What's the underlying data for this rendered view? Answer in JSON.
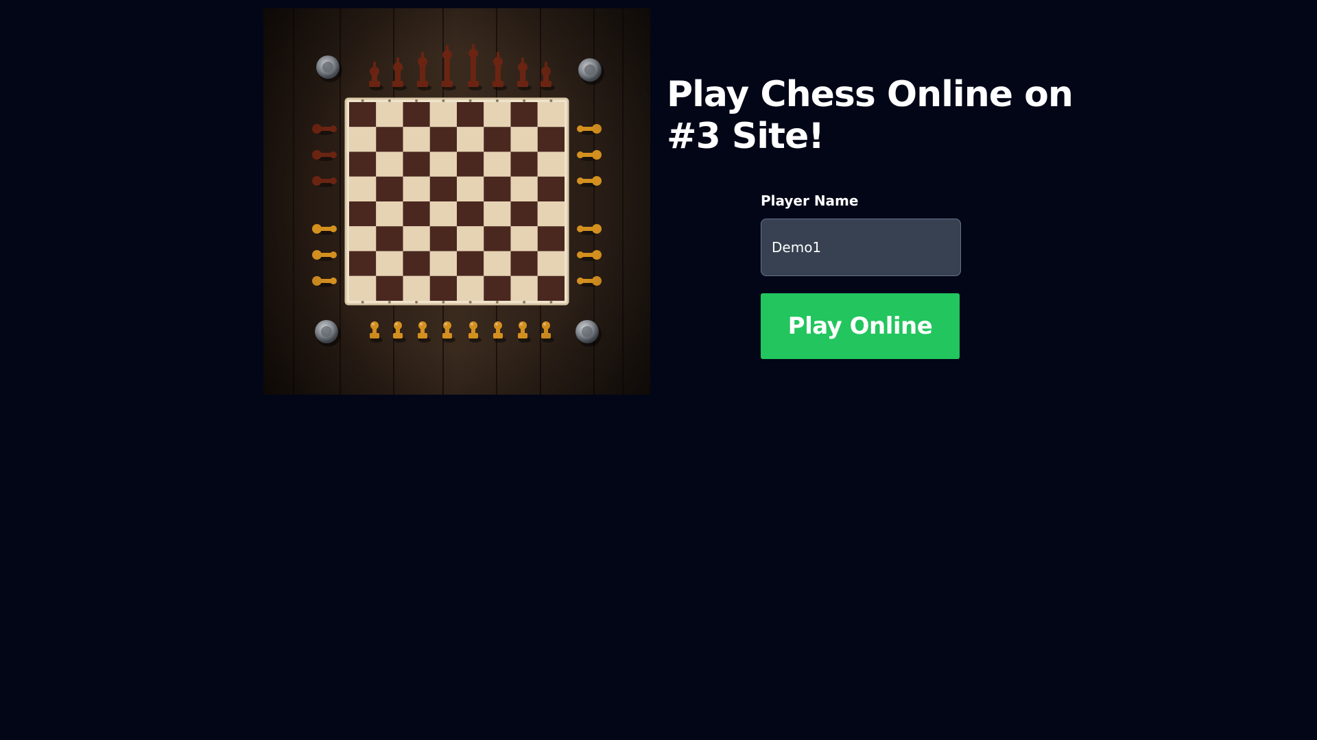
{
  "hero": {
    "image_subject": "chess-board-with-pieces",
    "colors": {
      "wood_dark": "#2a1d14",
      "light_square": "#e6d3b4",
      "dark_square": "#4a2820",
      "dark_piece": "#6b2412",
      "light_piece": "#d4901f",
      "silver_piece": "#b6bcc4"
    }
  },
  "title": "Play Chess Online on #3 Site!",
  "form": {
    "player_name_label": "Player Name",
    "player_name_value": "Demo1",
    "play_button_label": "Play Online"
  },
  "colors": {
    "background": "#020617",
    "input_background": "#374151",
    "button_accent": "#22c55e"
  }
}
